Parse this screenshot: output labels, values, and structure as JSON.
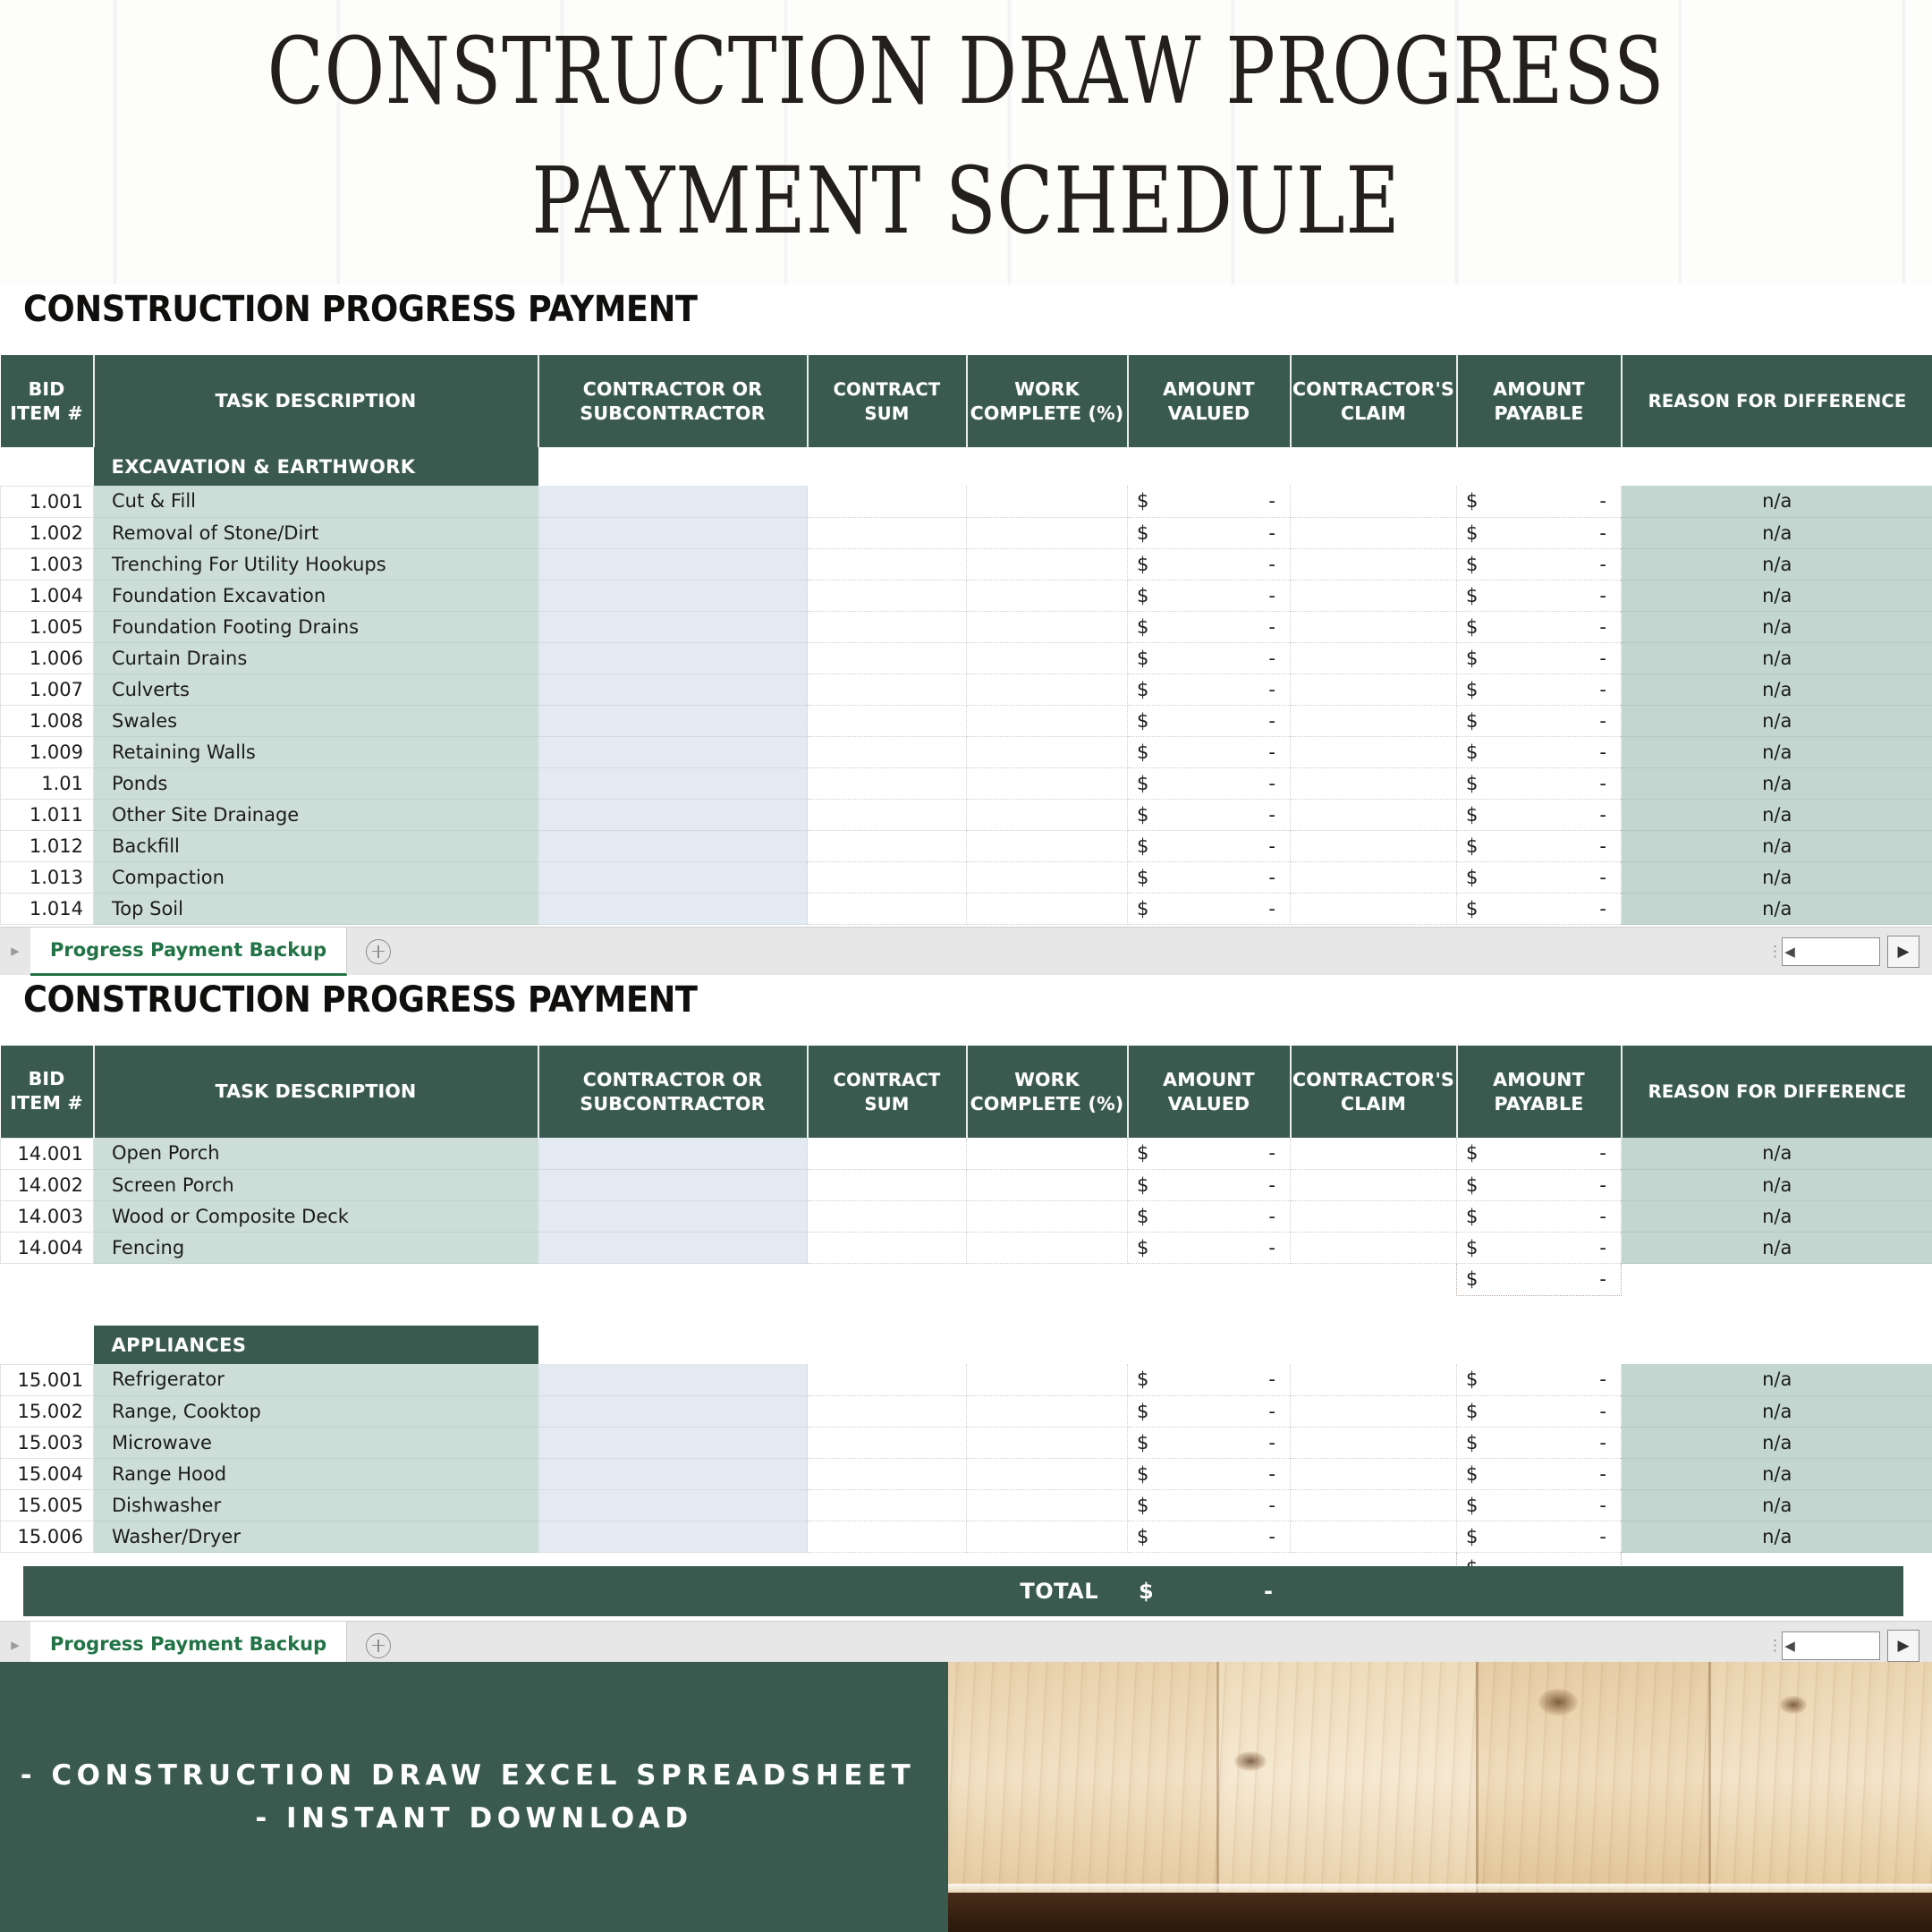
{
  "title": {
    "line1": "CONSTRUCTION DRAW PROGRESS",
    "line2": "PAYMENT SCHEDULE"
  },
  "sheet_heading": "CONSTRUCTION PROGRESS PAYMENT",
  "columns": [
    "BID\nITEM #",
    "TASK DESCRIPTION",
    "CONTRACTOR OR\nSUBCONTRACTOR",
    "CONTRACT SUM",
    "WORK\nCOMPLETE (%)",
    "AMOUNT\nVALUED",
    "CONTRACTOR'S\nCLAIM",
    "AMOUNT\nPAYABLE",
    "REASON FOR DIFFERENCE"
  ],
  "column_labels": {
    "bid_item_l1": "BID",
    "bid_item_l2": "ITEM #",
    "task_description": "TASK DESCRIPTION",
    "contractor_l1": "CONTRACTOR OR",
    "contractor_l2": "SUBCONTRACTOR",
    "contract_sum": "CONTRACT SUM",
    "work_complete_l1": "WORK",
    "work_complete_l2": "COMPLETE (%)",
    "amount_valued_l1": "AMOUNT",
    "amount_valued_l2": "VALUED",
    "contractors_claim_l1": "CONTRACTOR'S",
    "contractors_claim_l2": "CLAIM",
    "amount_payable_l1": "AMOUNT",
    "amount_payable_l2": "PAYABLE",
    "reason_for_difference": "REASON FOR DIFFERENCE"
  },
  "cell_defaults": {
    "currency_symbol": "$",
    "zero_dash": "-",
    "reason_value": "n/a",
    "empty": ""
  },
  "panel_top": {
    "section_label": "EXCAVATION & EARTHWORK",
    "rows": [
      {
        "bid": "1.001",
        "task": "Cut & Fill"
      },
      {
        "bid": "1.002",
        "task": "Removal of Stone/Dirt"
      },
      {
        "bid": "1.003",
        "task": "Trenching For Utility Hookups"
      },
      {
        "bid": "1.004",
        "task": "Foundation Excavation"
      },
      {
        "bid": "1.005",
        "task": "Foundation Footing Drains"
      },
      {
        "bid": "1.006",
        "task": "Curtain Drains"
      },
      {
        "bid": "1.007",
        "task": "Culverts"
      },
      {
        "bid": "1.008",
        "task": "Swales"
      },
      {
        "bid": "1.009",
        "task": "Retaining Walls"
      },
      {
        "bid": "1.01",
        "task": "Ponds"
      },
      {
        "bid": "1.011",
        "task": "Other Site Drainage"
      },
      {
        "bid": "1.012",
        "task": "Backfill"
      },
      {
        "bid": "1.013",
        "task": "Compaction"
      },
      {
        "bid": "1.014",
        "task": "Top Soil"
      }
    ]
  },
  "panel_bottom": {
    "group_a": {
      "rows": [
        {
          "bid": "14.001",
          "task": "Open Porch"
        },
        {
          "bid": "14.002",
          "task": "Screen Porch"
        },
        {
          "bid": "14.003",
          "task": "Wood or Composite Deck"
        },
        {
          "bid": "14.004",
          "task": "Fencing"
        }
      ]
    },
    "group_b": {
      "section_label": "APPLIANCES",
      "rows": [
        {
          "bid": "15.001",
          "task": "Refrigerator"
        },
        {
          "bid": "15.002",
          "task": "Range, Cooktop"
        },
        {
          "bid": "15.003",
          "task": "Microwave"
        },
        {
          "bid": "15.004",
          "task": "Range Hood"
        },
        {
          "bid": "15.005",
          "task": "Dishwasher"
        },
        {
          "bid": "15.006",
          "task": "Washer/Dryer"
        }
      ]
    },
    "total_row": {
      "label": "TOTAL",
      "currency_symbol": "$",
      "value": "-"
    }
  },
  "tabbar": {
    "sheet_name": "Progress Payment Backup",
    "add_sheet_icon": "plus-circle-icon",
    "left_arrow_icon": "chevron-right-icon",
    "scroll_left_icon": "scroll-left-arrow-icon",
    "scroll_right_icon": "scroll-right-arrow-icon"
  },
  "promo": {
    "line1": "- CONSTRUCTION DRAW EXCEL SPREADSHEET",
    "line2": "- INSTANT DOWNLOAD"
  },
  "colors": {
    "dark_green": "#3a5a50",
    "sage_row": "#cdddd7",
    "reason_green": "#c3d6d0",
    "subcontractor_blue": "#e4eaf1",
    "subtotal_pink": "#e8ddd9",
    "excel_tab_green": "#217346",
    "title_text": "#231f1c"
  }
}
